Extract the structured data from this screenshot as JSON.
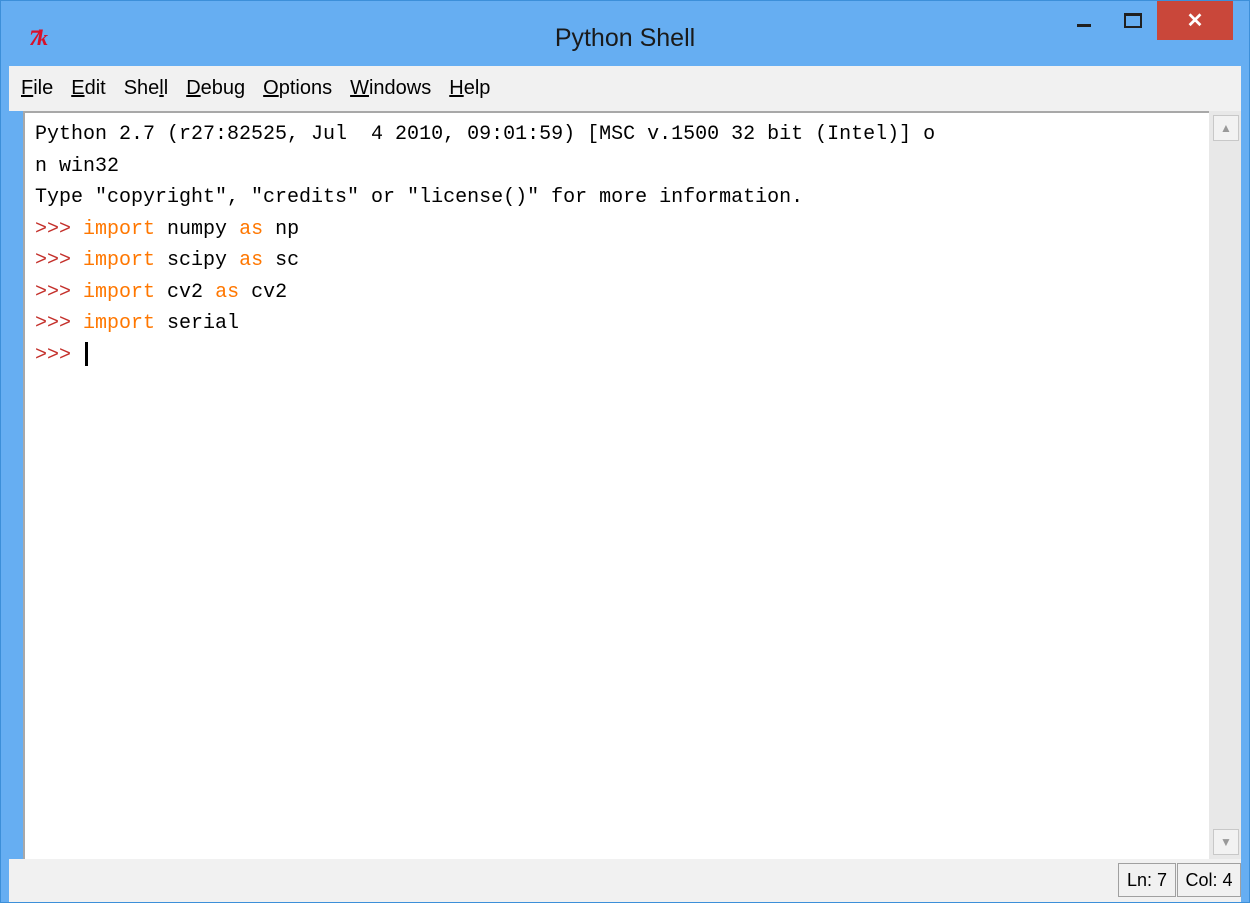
{
  "window": {
    "title": "Python Shell",
    "app_icon_text": "7k",
    "close_glyph": "✕"
  },
  "menu": [
    {
      "label": "File",
      "underline": "F"
    },
    {
      "label": "Edit",
      "underline": "E"
    },
    {
      "label": "Shell",
      "underline": "l"
    },
    {
      "label": "Debug",
      "underline": "D"
    },
    {
      "label": "Options",
      "underline": "O"
    },
    {
      "label": "Windows",
      "underline": "W"
    },
    {
      "label": "Help",
      "underline": "H"
    }
  ],
  "shell": {
    "banner_line1": "Python 2.7 (r27:82525, Jul  4 2010, 09:01:59) [MSC v.1500 32 bit (Intel)] o",
    "banner_line2": "n win32",
    "banner_line3": "Type \"copyright\", \"credits\" or \"license()\" for more information.",
    "prompt": ">>> ",
    "commands": [
      {
        "kw1": "import",
        "mod": "numpy",
        "kw2": "as",
        "alias": "np"
      },
      {
        "kw1": "import",
        "mod": "scipy",
        "kw2": "as",
        "alias": "sc"
      },
      {
        "kw1": "import",
        "mod": "cv2",
        "kw2": "as",
        "alias": "cv2"
      },
      {
        "kw1": "import",
        "mod": "serial",
        "kw2": "",
        "alias": ""
      }
    ]
  },
  "status": {
    "ln": "Ln: 7",
    "col": "Col: 4"
  },
  "colors": {
    "titlebar": "#66aef2",
    "close_button": "#c9473a",
    "prompt": "#c4302b",
    "keyword": "#ff7700"
  }
}
